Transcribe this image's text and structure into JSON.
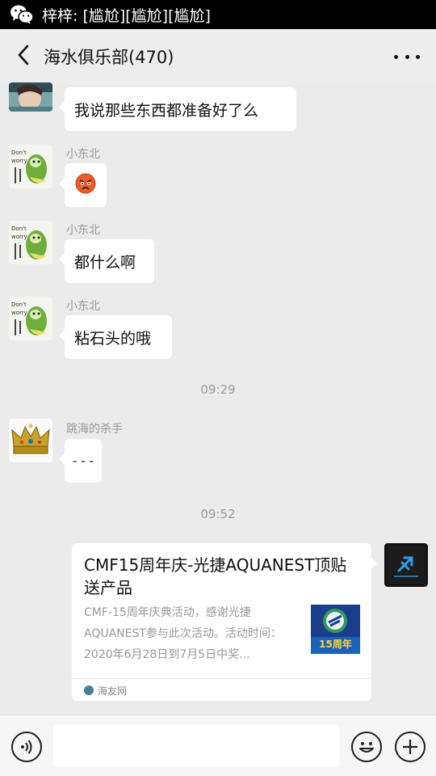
{
  "notification": {
    "app_icon": "wechat-icon",
    "text": "梓梓: [尴尬][尴尬][尴尬]"
  },
  "header": {
    "title": "海水俱乐部(470)",
    "back_icon": "chevron-left-icon",
    "more_icon": "more-dots-icon"
  },
  "messages": [
    {
      "sender": "",
      "text": "我说那些东西都准备好了么"
    },
    {
      "sender": "小东北",
      "text": "",
      "emoji": "angry-face-emoji"
    },
    {
      "sender": "小东北",
      "text": "都什么啊"
    },
    {
      "sender": "小东北",
      "text": "粘石头的哦"
    },
    {
      "sender": "跳海的杀手",
      "text": "- - -"
    }
  ],
  "times": [
    "09:29",
    "09:52"
  ],
  "link_card": {
    "title": "CMF15周年庆-光捷AQUANEST顶贴送产品",
    "description": "CMF-15周年庆典活动，感谢光捷AQUANEST参与此次活动。活动时间：2020年6月28日到7月5日中奖...",
    "thumb_text": "15周年",
    "source": "海友网"
  },
  "input_bar": {
    "voice_icon": "voice-icon",
    "emoji_icon": "emoji-icon",
    "add_icon": "plus-icon"
  },
  "colors": {
    "background": "#ebebeb",
    "header": "#ededed",
    "bubble": "#ffffff",
    "meta_text": "#9a9a9a"
  }
}
